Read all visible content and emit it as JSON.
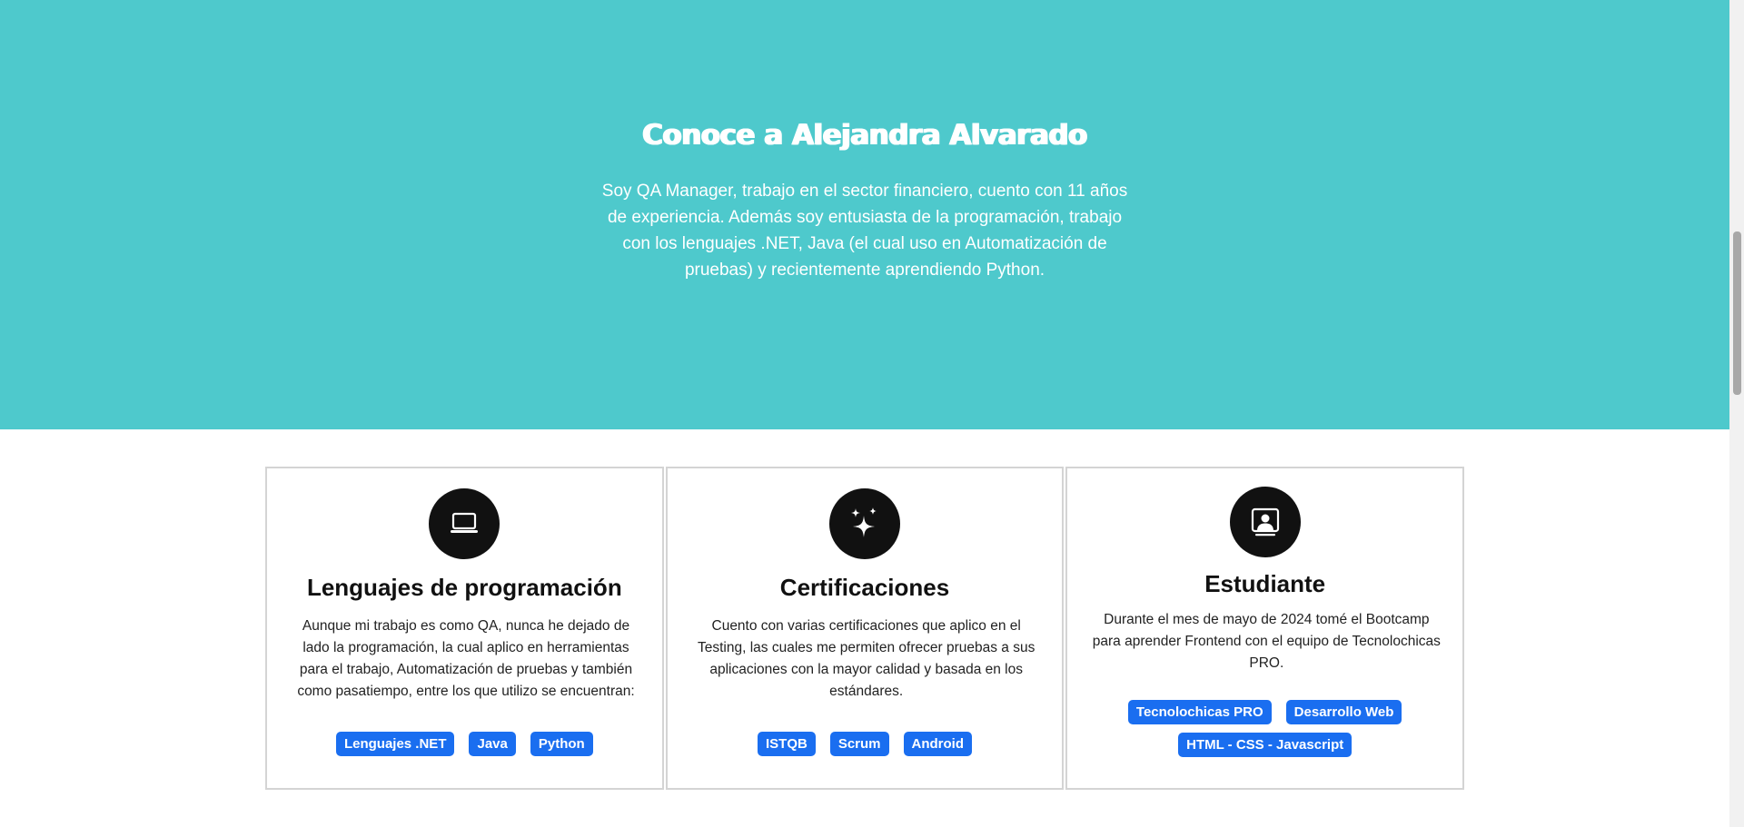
{
  "hero": {
    "title": "Conoce a Alejandra Alvarado",
    "description": "Soy QA Manager, trabajo en el sector financiero, cuento con 11 años de experiencia. Además soy entusiasta de la programación, trabajo con los lenguajes .NET, Java (el cual uso en Automatización de pruebas) y recientemente aprendiendo Python.",
    "background_color": "#4ec9cc"
  },
  "cards": [
    {
      "icon": "laptop-icon",
      "title": "Lenguajes de programación",
      "text": "Aunque mi trabajo es como QA, nunca he dejado de lado la programación, la cual aplico en herramientas para el trabajo, Automatización de pruebas y también como pasatiempo, entre los que utilizo se encuentran:",
      "badges": [
        "Lenguajes .NET",
        "Java",
        "Python"
      ]
    },
    {
      "icon": "sparkles-icon",
      "title": "Certificaciones",
      "text": "Cuento con varias certificaciones que aplico en el Testing, las cuales me permiten ofrecer pruebas a sus aplicaciones con la mayor calidad y basada en los estándares.",
      "badges": [
        "ISTQB",
        "Scrum",
        "Android"
      ]
    },
    {
      "icon": "person-video-icon",
      "title": "Estudiante",
      "text": "Durante el mes de mayo de 2024 tomé el Bootcamp para aprender Frontend con el equipo de Tecnolochicas PRO.",
      "badges": [
        "Tecnolochicas PRO",
        "Desarrollo Web",
        "HTML - CSS - Javascript"
      ]
    }
  ],
  "colors": {
    "badge": "#1a6ef0",
    "icon_circle": "#111111",
    "card_border": "#d4d4d4"
  }
}
